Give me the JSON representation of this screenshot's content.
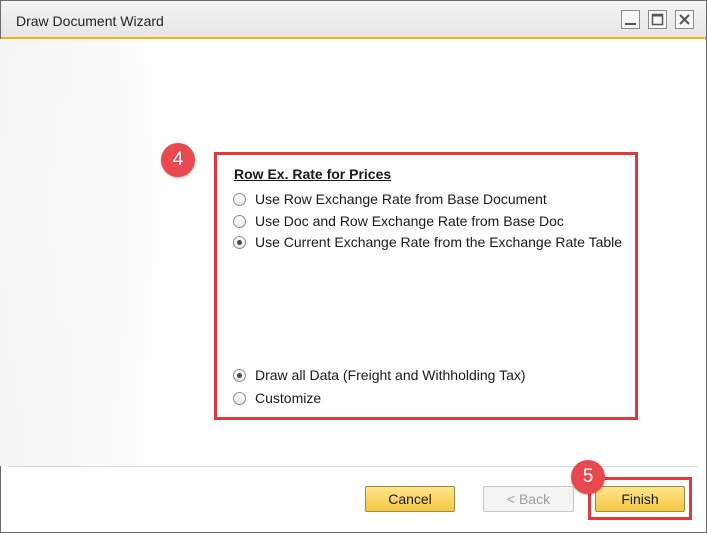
{
  "window": {
    "title": "Draw Document Wizard"
  },
  "callouts": {
    "step4": "4",
    "step5": "5"
  },
  "rate_section": {
    "title": "Row Ex. Rate for Prices",
    "options": [
      {
        "label": "Use Row Exchange Rate from Base Document",
        "selected": false
      },
      {
        "label": "Use Doc and Row Exchange Rate from Base Doc",
        "selected": false
      },
      {
        "label": "Use Current Exchange Rate from the Exchange Rate Table",
        "selected": true
      }
    ]
  },
  "data_section": {
    "options": [
      {
        "label": "Draw all Data (Freight and Withholding Tax)",
        "selected": true
      },
      {
        "label": "Customize",
        "selected": false
      }
    ]
  },
  "buttons": {
    "cancel": "Cancel",
    "back": "< Back",
    "finish": "Finish"
  },
  "colors": {
    "accent": "#f2b600",
    "callout": "#e03a3a",
    "badge": "#e9484f",
    "primary_button": "#f5c842"
  },
  "icons": {
    "minimize": "minimize-icon",
    "maximize": "maximize-icon",
    "close": "close-icon"
  }
}
